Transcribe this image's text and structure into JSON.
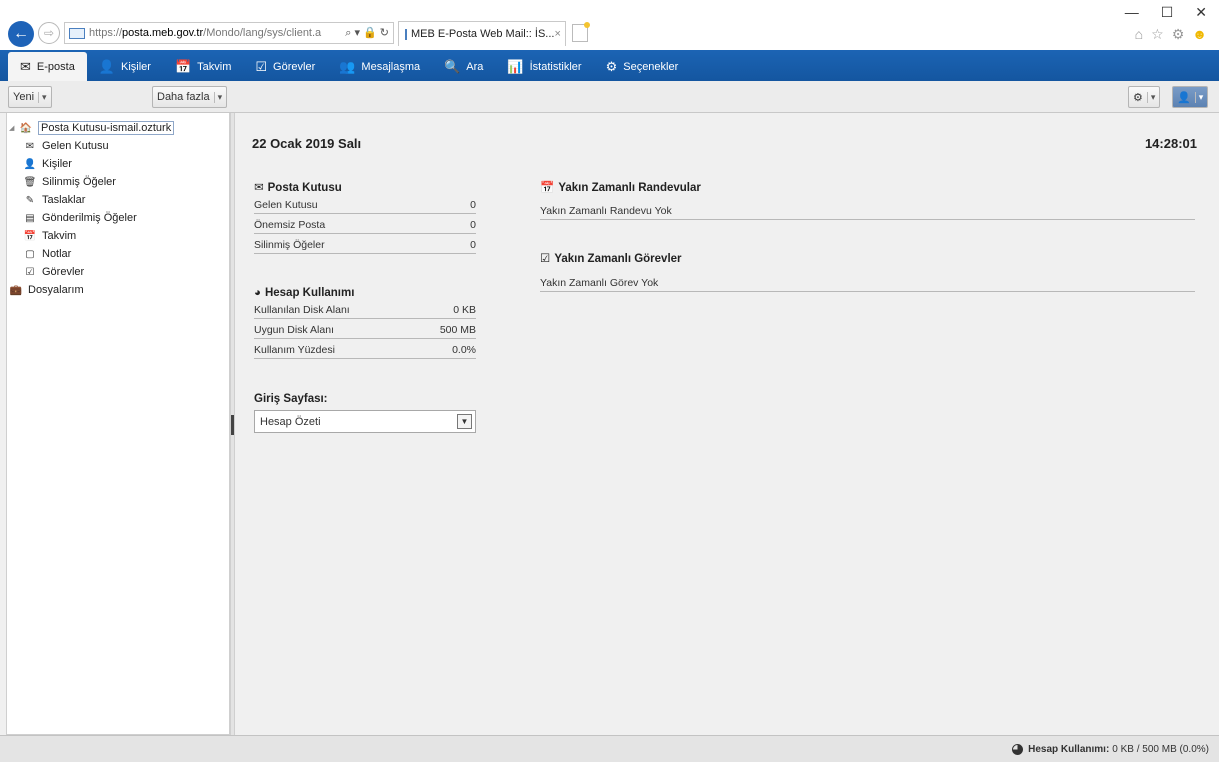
{
  "browser": {
    "url_prefix": "https://",
    "url_host": "posta.meb.gov.tr",
    "url_path": "/Mondo/lang/sys/client.a",
    "url_tools": "⌕ ▾ 🔒 ↻",
    "tab_title": "MEB E-Posta Web Mail:: İS...",
    "tab_close": "×",
    "back": "←",
    "forward": "⇨",
    "minimize": "—",
    "maximize": "☐",
    "close": "✕",
    "home_icon": "⌂",
    "star_icon": "☆",
    "gear_icon": "⚙",
    "smiley_icon": "☻"
  },
  "nav": {
    "items": [
      {
        "icon": "✉",
        "label": "E-posta"
      },
      {
        "icon": "👤",
        "label": "Kişiler"
      },
      {
        "icon": "📅",
        "label": "Takvim"
      },
      {
        "icon": "☑",
        "label": "Görevler"
      },
      {
        "icon": "👥",
        "label": "Mesajlaşma"
      },
      {
        "icon": "🔍",
        "label": "Ara"
      },
      {
        "icon": "📊",
        "label": "İstatistikler"
      },
      {
        "icon": "⚙",
        "label": "Seçenekler"
      }
    ]
  },
  "toolbar": {
    "new_label": "Yeni",
    "more_label": "Daha fazla",
    "dropdown": "▾",
    "settings_icon": "⚙",
    "user_icon": "👤"
  },
  "sidebar": {
    "root_label": "Posta Kutusu-ismail.ozturk",
    "root_icon": "🏠",
    "expand": "◢",
    "folders": [
      {
        "icon": "✉",
        "label": "Gelen Kutusu"
      },
      {
        "icon": "👤",
        "label": "Kişiler"
      },
      {
        "icon": "🗑",
        "label": "Silinmiş Öğeler"
      },
      {
        "icon": "✎",
        "label": "Taslaklar"
      },
      {
        "icon": "▤",
        "label": "Gönderilmiş Öğeler"
      },
      {
        "icon": "📅",
        "label": "Takvim"
      },
      {
        "icon": "▢",
        "label": "Notlar"
      },
      {
        "icon": "☑",
        "label": "Görevler"
      }
    ],
    "files_icon": "💼",
    "files_label": "Dosyalarım"
  },
  "main": {
    "date": "22 Ocak 2019 Salı",
    "time": "14:28:01",
    "mailbox": {
      "icon": "✉",
      "title": "Posta Kutusu",
      "rows": [
        {
          "label": "Gelen Kutusu",
          "value": "0"
        },
        {
          "label": "Önemsiz Posta",
          "value": "0"
        },
        {
          "label": "Silinmiş Öğeler",
          "value": "0"
        }
      ]
    },
    "usage": {
      "icon": "◕",
      "title": "Hesap Kullanımı",
      "rows": [
        {
          "label": "Kullanılan Disk Alanı",
          "value": "0 KB"
        },
        {
          "label": "Uygun Disk Alanı",
          "value": "500 MB"
        },
        {
          "label": "Kullanım Yüzdesi",
          "value": "0.0%"
        }
      ]
    },
    "homepage": {
      "title": "Giriş Sayfası:",
      "selected": "Hesap Özeti",
      "arrow": "▼"
    },
    "appointments": {
      "icon": "📅",
      "title": "Yakın Zamanlı Randevular",
      "empty": "Yakın Zamanlı Randevu Yok"
    },
    "tasks": {
      "icon": "☑",
      "title": "Yakın Zamanlı Görevler",
      "empty": "Yakın Zamanlı Görev Yok"
    }
  },
  "status": {
    "label": "Hesap Kullanımı:",
    "value": "0 KB / 500 MB (0.0%)"
  }
}
